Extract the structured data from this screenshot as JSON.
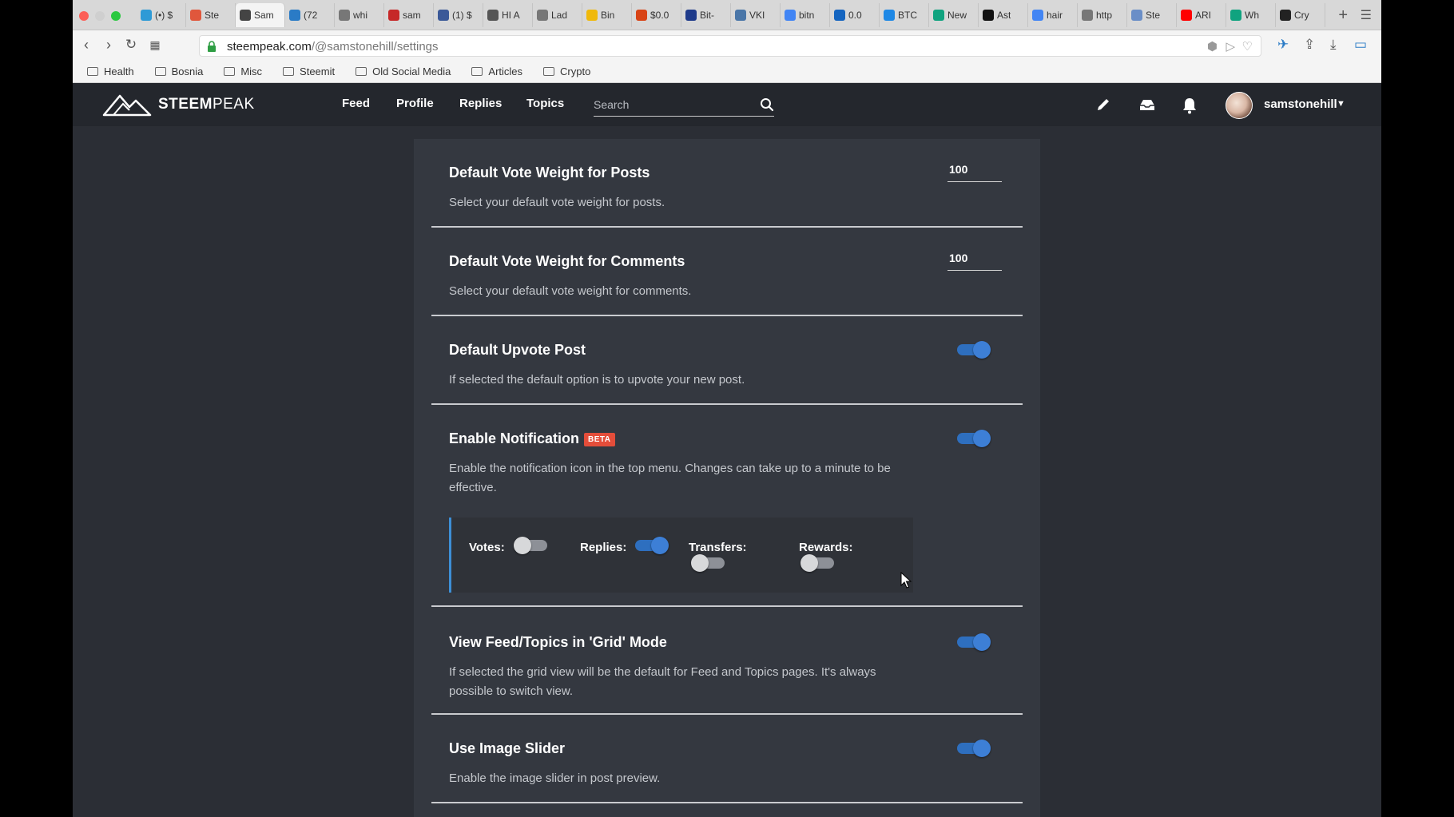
{
  "browser": {
    "tabs": [
      {
        "title": "(•) $",
        "color": "#2e9ad6"
      },
      {
        "title": "Ste",
        "color": "#e0573c"
      },
      {
        "title": "Sam",
        "color": "#444444",
        "active": true
      },
      {
        "title": "(72",
        "color": "#2a7bc6"
      },
      {
        "title": "whi",
        "color": "#777777"
      },
      {
        "title": "sam",
        "color": "#c62828"
      },
      {
        "title": "(1) $",
        "color": "#3b5998"
      },
      {
        "title": "HI A",
        "color": "#555555"
      },
      {
        "title": "Lad",
        "color": "#777777"
      },
      {
        "title": "Bin",
        "color": "#f0b90b"
      },
      {
        "title": "$0.0",
        "color": "#d84315"
      },
      {
        "title": "Bit-",
        "color": "#1e3a8a"
      },
      {
        "title": "VKI",
        "color": "#4a76a8"
      },
      {
        "title": "bitn",
        "color": "#4285f4"
      },
      {
        "title": "0.0",
        "color": "#1565c0"
      },
      {
        "title": "BTC",
        "color": "#1e88e5"
      },
      {
        "title": "New",
        "color": "#10a37f"
      },
      {
        "title": "Ast",
        "color": "#111111"
      },
      {
        "title": "hair",
        "color": "#4285f4"
      },
      {
        "title": "http",
        "color": "#777777"
      },
      {
        "title": "Ste",
        "color": "#6a8ec7"
      },
      {
        "title": "ARI",
        "color": "#ff0000"
      },
      {
        "title": "Wh",
        "color": "#10a37f"
      },
      {
        "title": "Cry",
        "color": "#222222"
      }
    ],
    "url_domain": "steempeak.com",
    "url_path": "/@samstonehill/settings",
    "bookmarks": [
      "Health",
      "Bosnia",
      "Misc",
      "Steemit",
      "Old Social Media",
      "Articles",
      "Crypto"
    ]
  },
  "header": {
    "logo_bold": "STEEM",
    "logo_light": "PEAK",
    "nav": [
      "Feed",
      "Profile",
      "Replies",
      "Topics"
    ],
    "search_placeholder": "Search",
    "username": "samstonehill"
  },
  "settings": {
    "vote_posts": {
      "title": "Default Vote Weight for Posts",
      "desc": "Select your default vote weight for posts.",
      "value": "100"
    },
    "vote_comments": {
      "title": "Default Vote Weight for Comments",
      "desc": "Select your default vote weight for comments.",
      "value": "100"
    },
    "upvote_post": {
      "title": "Default Upvote Post",
      "desc": "If selected the default option is to upvote your new post.",
      "on": true
    },
    "notification": {
      "title": "Enable Notification",
      "badge": "BETA",
      "desc": "Enable the notification icon in the top menu. Changes can take up to a minute to be effective.",
      "on": true,
      "votes_label": "Votes:",
      "votes_on": false,
      "replies_label": "Replies:",
      "replies_on": true,
      "transfers_label": "Transfers:",
      "transfers_on": false,
      "rewards_label": "Rewards:",
      "rewards_on": false
    },
    "grid_mode": {
      "title": "View Feed/Topics in 'Grid' Mode",
      "desc": "If selected the grid view will be the default for Feed and Topics pages. It's always possible to switch view.",
      "on": true
    },
    "image_slider": {
      "title": "Use Image Slider",
      "desc": "Enable the image slider in post preview.",
      "on": true
    }
  },
  "colors": {
    "accent": "#3d7fd6",
    "badge": "#e44d3a",
    "page_bg": "#2b2e35",
    "panel_bg": "#343840",
    "header_bg": "#24272d"
  }
}
